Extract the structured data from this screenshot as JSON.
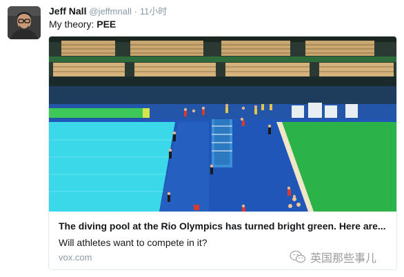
{
  "tweet": {
    "author_name": "Jeff Nall",
    "author_handle": "@jeffmnall",
    "separator": "·",
    "time": "11小时",
    "text_prefix": "My theory: ",
    "text_bold": "PEE"
  },
  "card": {
    "title": "The diving pool at the Rio Olympics has turned bright green. Here are...",
    "description": "Will athletes want to compete in it?",
    "domain": "vox.com"
  },
  "watermark": {
    "text": "英国那些事儿",
    "icon": "wechat-icon"
  },
  "colors": {
    "blue_pool": "#3ad8e8",
    "green_pool": "#2bb34a",
    "deck_blue": "#1f56b8",
    "muted_text": "#8899a6"
  }
}
